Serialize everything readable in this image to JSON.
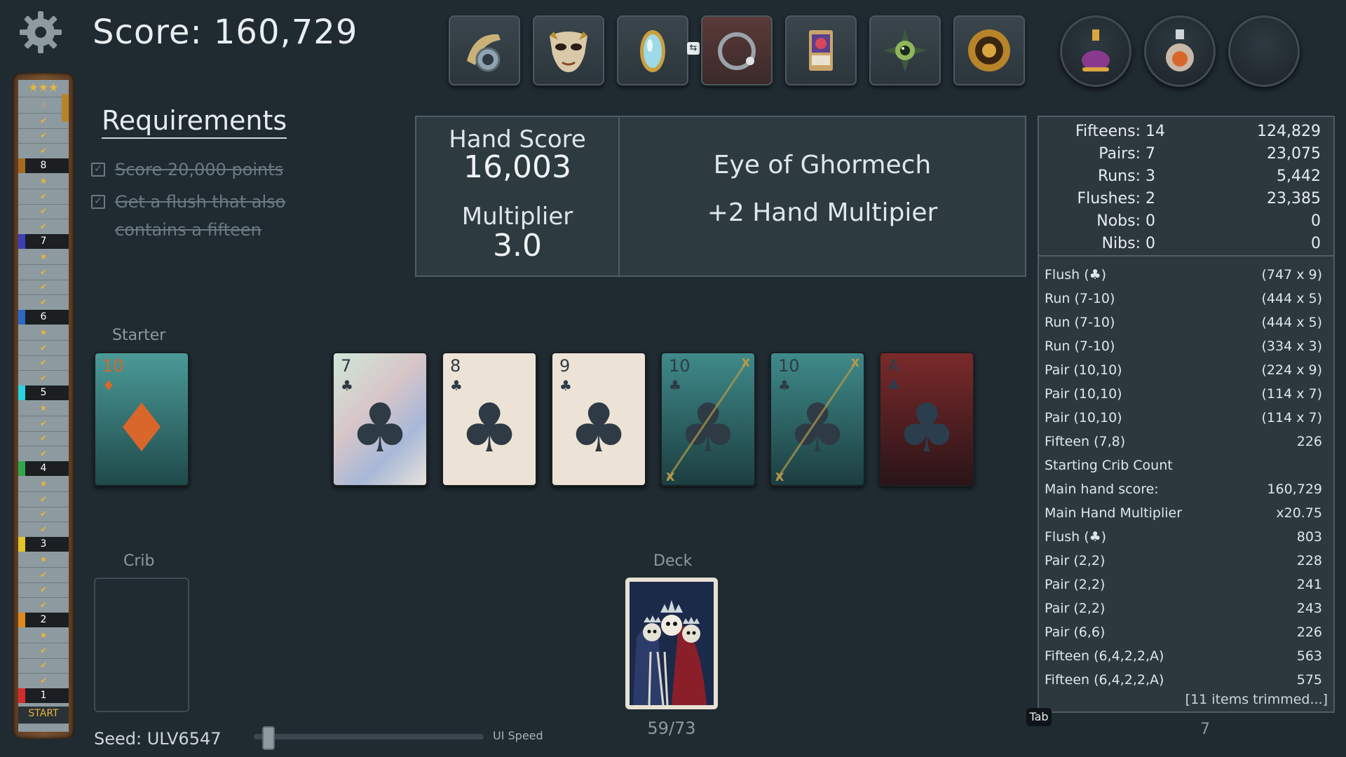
{
  "header": {
    "score_text": "Score: 160,729"
  },
  "requirements": {
    "title": "Requirements",
    "items": [
      "Score 20,000 points",
      "Get a flush that also",
      "contains a fifteen"
    ]
  },
  "track": {
    "top_icon": "★★★",
    "levels": [
      "8",
      "7",
      "6",
      "5",
      "4",
      "3",
      "2",
      "1"
    ],
    "level_colors": [
      "#a66a1e",
      "#3a3fb8",
      "#2c68c8",
      "#2ad3e0",
      "#2fa84a",
      "#e0c42a",
      "#e08a1e",
      "#d62b2b"
    ],
    "start_label": "START"
  },
  "hand": {
    "score_label": "Hand Score",
    "score_value": "16,003",
    "mult_label": "Multiplier",
    "mult_value": "3.0",
    "relic_name": "Eye of Ghormech",
    "relic_effect": "+2 Hand Multipier"
  },
  "stats": [
    {
      "name": "Fifteens:",
      "count": "14",
      "value": "124,829"
    },
    {
      "name": "Pairs:",
      "count": "7",
      "value": "23,075"
    },
    {
      "name": "Runs:",
      "count": "3",
      "value": "5,442"
    },
    {
      "name": "Flushes:",
      "count": "2",
      "value": "23,385"
    },
    {
      "name": "Nobs:",
      "count": "0",
      "value": "0"
    },
    {
      "name": "Nibs:",
      "count": "0",
      "value": "0"
    }
  ],
  "breakdown": [
    {
      "label": "Flush (♣)",
      "value": "(747 x 9)"
    },
    {
      "label": "Run (7-10)",
      "value": "(444 x 5)"
    },
    {
      "label": "Run (7-10)",
      "value": "(444 x 5)"
    },
    {
      "label": "Run (7-10)",
      "value": "(334 x 3)"
    },
    {
      "label": "Pair (10,10)",
      "value": "(224 x 9)"
    },
    {
      "label": "Pair (10,10)",
      "value": "(114 x 7)"
    },
    {
      "label": "Pair (10,10)",
      "value": "(114 x 7)"
    },
    {
      "label": "Fifteen (7,8)",
      "value": "226"
    },
    {
      "label": "Starting Crib Count",
      "value": ""
    },
    {
      "label": "Main hand score:",
      "value": "160,729"
    },
    {
      "label": "Main Hand Multiplier",
      "value": "x20.75"
    },
    {
      "label": "Flush (♣)",
      "value": "803"
    },
    {
      "label": "Pair (2,2)",
      "value": "228"
    },
    {
      "label": "Pair (2,2)",
      "value": "241"
    },
    {
      "label": "Pair (2,2)",
      "value": "243"
    },
    {
      "label": "Pair (6,6)",
      "value": "226"
    },
    {
      "label": "Fifteen (6,4,2,2,A)",
      "value": "563"
    },
    {
      "label": "Fifteen (6,4,2,2,A)",
      "value": "575"
    }
  ],
  "trimmed_text": "[11 items trimmed...]",
  "starter": {
    "label": "Starter",
    "rank": "10",
    "suit": "♦"
  },
  "hand_cards": [
    {
      "rank": "7",
      "suit": "♣",
      "style": "holo"
    },
    {
      "rank": "8",
      "suit": "♣",
      "style": "plain"
    },
    {
      "rank": "9",
      "suit": "♣",
      "style": "plain"
    },
    {
      "rank": "10",
      "suit": "♣",
      "style": "teal",
      "marked": "X"
    },
    {
      "rank": "10",
      "suit": "♣",
      "style": "teal",
      "marked": "X"
    },
    {
      "rank": "A",
      "suit": "♣",
      "style": "red"
    }
  ],
  "crib_label": "Crib",
  "deck": {
    "label": "Deck",
    "count": "59/73"
  },
  "footer": {
    "seed": "Seed: ULV6547",
    "speed_label": "UI Speed",
    "speed_fraction": 0.04,
    "tab_key": "Tab",
    "page_number": "7"
  },
  "relics": [
    "horn-icon",
    "mask-icon",
    "mirror-icon",
    "ring-icon",
    "card-relic-icon",
    "eye-icon",
    "sun-emblem-icon"
  ],
  "potions": [
    "purple-potion-icon",
    "orange-potion-icon",
    "empty-potion-slot"
  ]
}
